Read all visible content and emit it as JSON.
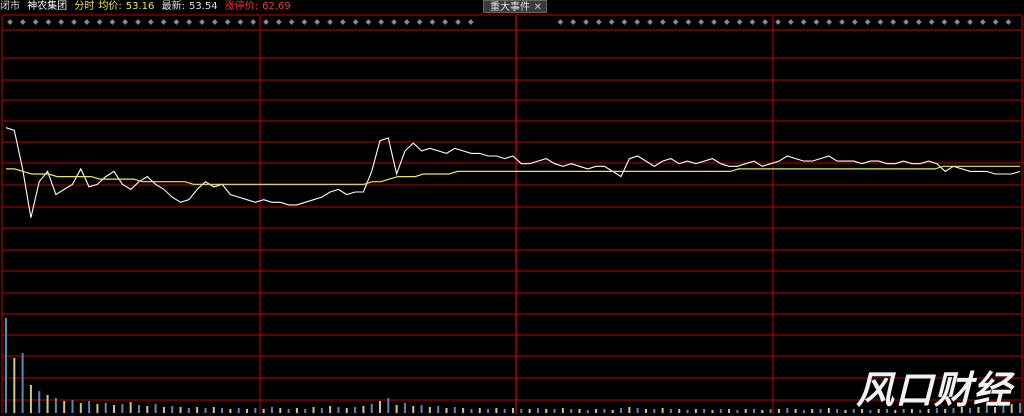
{
  "header": {
    "status": "闭市",
    "stock_name": "神农集团",
    "mode": "分时",
    "avg_label": "均价:",
    "avg_value": "53.16",
    "last_label": "最新:",
    "last_value": "53.54",
    "limit_label": "涨停价:",
    "limit_value": "62.69"
  },
  "event_tab": {
    "label": "重大事件",
    "close": "✕"
  },
  "watermark": "风口财经",
  "colors": {
    "grid": "#c00000",
    "price_line": "#ffffff",
    "avg_line": "#e8e860",
    "marker": "#8a8a8a",
    "vol_a": "#5a8ab0",
    "vol_b": "#c8c890"
  },
  "chart_data": {
    "type": "line",
    "series": [
      {
        "values": [
          54.7,
          54.6,
          53.1,
          51.2,
          52.6,
          53.0,
          52.1,
          52.3,
          52.5,
          53.1,
          52.4,
          52.5,
          52.8,
          53.0,
          52.5,
          52.3,
          52.6,
          52.8,
          52.5,
          52.3,
          52.0,
          51.8,
          51.9,
          52.3,
          52.6,
          52.4,
          52.5,
          52.1,
          52.0,
          51.9,
          51.8,
          51.9,
          51.8,
          51.8,
          51.7,
          51.7,
          51.8,
          51.9,
          52.0,
          52.2,
          52.3,
          52.1,
          52.2,
          52.2,
          53.0,
          54.2,
          54.3,
          52.9,
          53.8,
          54.1,
          53.8,
          53.9,
          53.8,
          53.7,
          53.9,
          53.8,
          53.7,
          53.7,
          53.6,
          53.6,
          53.5,
          53.6,
          53.3,
          53.3,
          53.4,
          53.5,
          53.3,
          53.2,
          53.3,
          53.2,
          53.1,
          53.2,
          53.2,
          53.0,
          52.8,
          53.5,
          53.6,
          53.4,
          53.2,
          53.4,
          53.5,
          53.3,
          53.4,
          53.3,
          53.4,
          53.5,
          53.3,
          53.2,
          53.2,
          53.3,
          53.4,
          53.2,
          53.3,
          53.4,
          53.6,
          53.5,
          53.4,
          53.4,
          53.5,
          53.6,
          53.4,
          53.4,
          53.4,
          53.3,
          53.4,
          53.4,
          53.3,
          53.3,
          53.4,
          53.3,
          53.3,
          53.4,
          53.3,
          53.0,
          53.2,
          53.1,
          53.0,
          53.0,
          53.0,
          52.9,
          52.9,
          52.9,
          53.0
        ],
        "color": "#ffffff"
      },
      {
        "values": [
          53.1,
          53.1,
          53.0,
          52.9,
          52.9,
          52.9,
          52.8,
          52.8,
          52.8,
          52.8,
          52.8,
          52.7,
          52.7,
          52.7,
          52.7,
          52.7,
          52.6,
          52.6,
          52.6,
          52.6,
          52.6,
          52.6,
          52.5,
          52.5,
          52.5,
          52.5,
          52.5,
          52.5,
          52.5,
          52.5,
          52.5,
          52.5,
          52.5,
          52.5,
          52.5,
          52.5,
          52.5,
          52.5,
          52.5,
          52.5,
          52.5,
          52.5,
          52.5,
          52.6,
          52.6,
          52.7,
          52.8,
          52.8,
          52.8,
          52.9,
          52.9,
          52.9,
          52.9,
          53.0,
          53.0,
          53.0,
          53.0,
          53.0,
          53.0,
          53.0,
          53.0,
          53.0,
          53.0,
          53.0,
          53.0,
          53.0,
          53.0,
          53.0,
          53.0,
          53.0,
          53.0,
          53.0,
          53.0,
          53.0,
          53.0,
          53.0,
          53.0,
          53.0,
          53.0,
          53.0,
          53.0,
          53.0,
          53.0,
          53.0,
          53.0,
          53.0,
          53.1,
          53.1,
          53.1,
          53.1,
          53.1,
          53.1,
          53.1,
          53.1,
          53.1,
          53.1,
          53.1,
          53.1,
          53.1,
          53.1,
          53.1,
          53.1,
          53.1,
          53.1,
          53.1,
          53.1,
          53.1,
          53.1,
          53.1,
          53.1,
          53.2,
          53.2,
          53.2,
          53.2,
          53.2,
          53.2,
          53.2,
          53.2,
          53.2,
          53.2
        ],
        "color": "#e8e860"
      }
    ],
    "volume": [
      0.95,
      0.55,
      0.6,
      0.28,
      0.22,
      0.18,
      0.15,
      0.12,
      0.13,
      0.1,
      0.12,
      0.09,
      0.1,
      0.08,
      0.09,
      0.11,
      0.08,
      0.07,
      0.09,
      0.06,
      0.07,
      0.06,
      0.05,
      0.06,
      0.05,
      0.06,
      0.05,
      0.04,
      0.05,
      0.04,
      0.05,
      0.04,
      0.06,
      0.05,
      0.04,
      0.05,
      0.04,
      0.06,
      0.05,
      0.07,
      0.06,
      0.05,
      0.06,
      0.07,
      0.09,
      0.12,
      0.15,
      0.08,
      0.1,
      0.07,
      0.08,
      0.06,
      0.07,
      0.05,
      0.06,
      0.05,
      0.04,
      0.05,
      0.04,
      0.05,
      0.04,
      0.05,
      0.04,
      0.04,
      0.05,
      0.04,
      0.04,
      0.05,
      0.04,
      0.04,
      0.03,
      0.04,
      0.04,
      0.03,
      0.05,
      0.06,
      0.05,
      0.04,
      0.04,
      0.05,
      0.04,
      0.04,
      0.03,
      0.04,
      0.04,
      0.03,
      0.04,
      0.04,
      0.03,
      0.04,
      0.04,
      0.03,
      0.04,
      0.04,
      0.05,
      0.04,
      0.03,
      0.04,
      0.04,
      0.05,
      0.04,
      0.03,
      0.04,
      0.04,
      0.03,
      0.04,
      0.04,
      0.03,
      0.04,
      0.04,
      0.03,
      0.04,
      0.05,
      0.04,
      0.05,
      0.06,
      0.05,
      0.06,
      0.07,
      0.06,
      0.08,
      0.09,
      0.1
    ]
  }
}
